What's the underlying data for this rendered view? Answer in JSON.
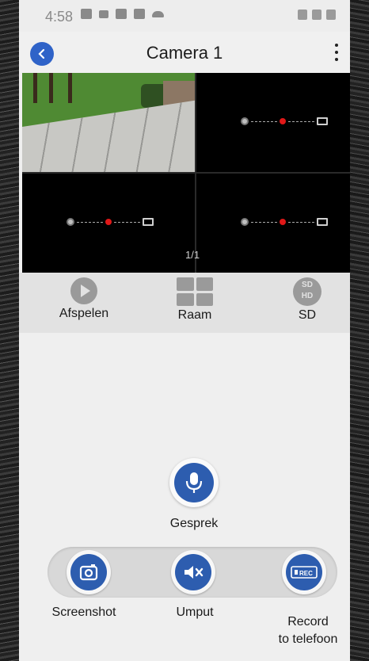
{
  "status_bar": {
    "time": "4:58"
  },
  "header": {
    "title": "Camera 1"
  },
  "video": {
    "page_indicator": "1/1"
  },
  "toolbar": {
    "playback_label": "Afspelen",
    "window_label": "Raam",
    "quality_label": "SD",
    "sd_text": "SD",
    "hd_text": "HD"
  },
  "controls": {
    "talk_label": "Gesprek",
    "screenshot_label": "Screenshot",
    "mute_label": "Umput",
    "record_label_line1": "Record",
    "record_label_line2": "to telefoon",
    "rec_badge": "REC"
  },
  "colors": {
    "accent": "#2d5daf",
    "back_button": "#2f63c8",
    "offline_dot": "#e01818"
  }
}
